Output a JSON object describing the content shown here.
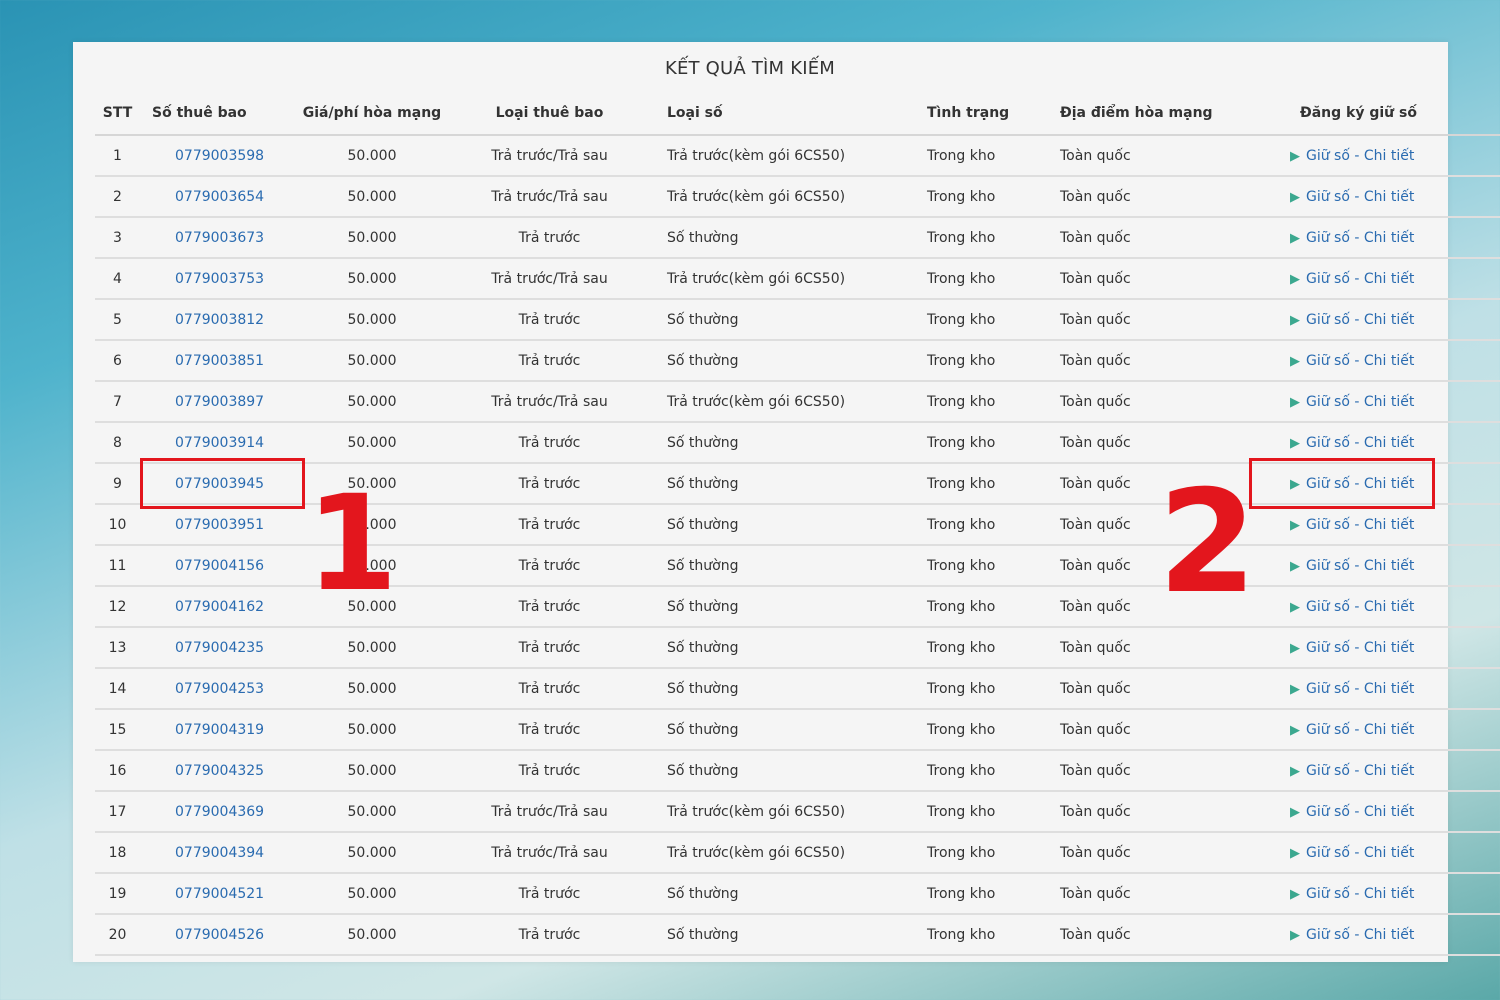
{
  "title": "KẾT QUẢ TÌM KIẾM",
  "columns": [
    "STT",
    "Số thuê bao",
    "Giá/phí hòa mạng",
    "Loại thuê bao",
    "Loại số",
    "Tình trạng",
    "Địa điểm hòa mạng",
    "Đăng ký giữ số"
  ],
  "rows": [
    {
      "stt": "1",
      "number": "0779003598",
      "fee": "50.000",
      "sub_type": "Trả trước/Trả sau",
      "num_type": "Trả trước(kèm gói 6CS50)",
      "status": "Trong kho",
      "place": "Toàn quốc",
      "hold": "Giữ số",
      "sep": "-",
      "detail": "Chi tiết"
    },
    {
      "stt": "2",
      "number": "0779003654",
      "fee": "50.000",
      "sub_type": "Trả trước/Trả sau",
      "num_type": "Trả trước(kèm gói 6CS50)",
      "status": "Trong kho",
      "place": "Toàn quốc",
      "hold": "Giữ số",
      "sep": "-",
      "detail": "Chi tiết"
    },
    {
      "stt": "3",
      "number": "0779003673",
      "fee": "50.000",
      "sub_type": "Trả trước",
      "num_type": "Số thường",
      "status": "Trong kho",
      "place": "Toàn quốc",
      "hold": "Giữ số",
      "sep": "-",
      "detail": "Chi tiết"
    },
    {
      "stt": "4",
      "number": "0779003753",
      "fee": "50.000",
      "sub_type": "Trả trước/Trả sau",
      "num_type": "Trả trước(kèm gói 6CS50)",
      "status": "Trong kho",
      "place": "Toàn quốc",
      "hold": "Giữ số",
      "sep": "-",
      "detail": "Chi tiết"
    },
    {
      "stt": "5",
      "number": "0779003812",
      "fee": "50.000",
      "sub_type": "Trả trước",
      "num_type": "Số thường",
      "status": "Trong kho",
      "place": "Toàn quốc",
      "hold": "Giữ số",
      "sep": "-",
      "detail": "Chi tiết"
    },
    {
      "stt": "6",
      "number": "0779003851",
      "fee": "50.000",
      "sub_type": "Trả trước",
      "num_type": "Số thường",
      "status": "Trong kho",
      "place": "Toàn quốc",
      "hold": "Giữ số",
      "sep": "-",
      "detail": "Chi tiết"
    },
    {
      "stt": "7",
      "number": "0779003897",
      "fee": "50.000",
      "sub_type": "Trả trước/Trả sau",
      "num_type": "Trả trước(kèm gói 6CS50)",
      "status": "Trong kho",
      "place": "Toàn quốc",
      "hold": "Giữ số",
      "sep": "-",
      "detail": "Chi tiết"
    },
    {
      "stt": "8",
      "number": "0779003914",
      "fee": "50.000",
      "sub_type": "Trả trước",
      "num_type": "Số thường",
      "status": "Trong kho",
      "place": "Toàn quốc",
      "hold": "Giữ số",
      "sep": "-",
      "detail": "Chi tiết"
    },
    {
      "stt": "9",
      "number": "0779003945",
      "fee": "50.000",
      "sub_type": "Trả trước",
      "num_type": "Số thường",
      "status": "Trong kho",
      "place": "Toàn quốc",
      "hold": "Giữ số",
      "sep": "-",
      "detail": "Chi tiết"
    },
    {
      "stt": "10",
      "number": "0779003951",
      "fee": "50.000",
      "sub_type": "Trả trước",
      "num_type": "Số thường",
      "status": "Trong kho",
      "place": "Toàn quốc",
      "hold": "Giữ số",
      "sep": "-",
      "detail": "Chi tiết"
    },
    {
      "stt": "11",
      "number": "0779004156",
      "fee": "50.000",
      "sub_type": "Trả trước",
      "num_type": "Số thường",
      "status": "Trong kho",
      "place": "Toàn quốc",
      "hold": "Giữ số",
      "sep": "-",
      "detail": "Chi tiết"
    },
    {
      "stt": "12",
      "number": "0779004162",
      "fee": "50.000",
      "sub_type": "Trả trước",
      "num_type": "Số thường",
      "status": "Trong kho",
      "place": "Toàn quốc",
      "hold": "Giữ số",
      "sep": "-",
      "detail": "Chi tiết"
    },
    {
      "stt": "13",
      "number": "0779004235",
      "fee": "50.000",
      "sub_type": "Trả trước",
      "num_type": "Số thường",
      "status": "Trong kho",
      "place": "Toàn quốc",
      "hold": "Giữ số",
      "sep": "-",
      "detail": "Chi tiết"
    },
    {
      "stt": "14",
      "number": "0779004253",
      "fee": "50.000",
      "sub_type": "Trả trước",
      "num_type": "Số thường",
      "status": "Trong kho",
      "place": "Toàn quốc",
      "hold": "Giữ số",
      "sep": "-",
      "detail": "Chi tiết"
    },
    {
      "stt": "15",
      "number": "0779004319",
      "fee": "50.000",
      "sub_type": "Trả trước",
      "num_type": "Số thường",
      "status": "Trong kho",
      "place": "Toàn quốc",
      "hold": "Giữ số",
      "sep": "-",
      "detail": "Chi tiết"
    },
    {
      "stt": "16",
      "number": "0779004325",
      "fee": "50.000",
      "sub_type": "Trả trước",
      "num_type": "Số thường",
      "status": "Trong kho",
      "place": "Toàn quốc",
      "hold": "Giữ số",
      "sep": "-",
      "detail": "Chi tiết"
    },
    {
      "stt": "17",
      "number": "0779004369",
      "fee": "50.000",
      "sub_type": "Trả trước/Trả sau",
      "num_type": "Trả trước(kèm gói 6CS50)",
      "status": "Trong kho",
      "place": "Toàn quốc",
      "hold": "Giữ số",
      "sep": "-",
      "detail": "Chi tiết"
    },
    {
      "stt": "18",
      "number": "0779004394",
      "fee": "50.000",
      "sub_type": "Trả trước/Trả sau",
      "num_type": "Trả trước(kèm gói 6CS50)",
      "status": "Trong kho",
      "place": "Toàn quốc",
      "hold": "Giữ số",
      "sep": "-",
      "detail": "Chi tiết"
    },
    {
      "stt": "19",
      "number": "0779004521",
      "fee": "50.000",
      "sub_type": "Trả trước",
      "num_type": "Số thường",
      "status": "Trong kho",
      "place": "Toàn quốc",
      "hold": "Giữ số",
      "sep": "-",
      "detail": "Chi tiết"
    },
    {
      "stt": "20",
      "number": "0779004526",
      "fee": "50.000",
      "sub_type": "Trả trước",
      "num_type": "Số thường",
      "status": "Trong kho",
      "place": "Toàn quốc",
      "hold": "Giữ số",
      "sep": "-",
      "detail": "Chi tiết"
    }
  ],
  "annotations": {
    "label_1": "1",
    "label_2": "2",
    "color": "#e3161d"
  },
  "colors": {
    "link": "#2a6bb0",
    "arrow": "#3ba88f"
  },
  "icons": {
    "row_arrow": "chevron-right-icon"
  }
}
